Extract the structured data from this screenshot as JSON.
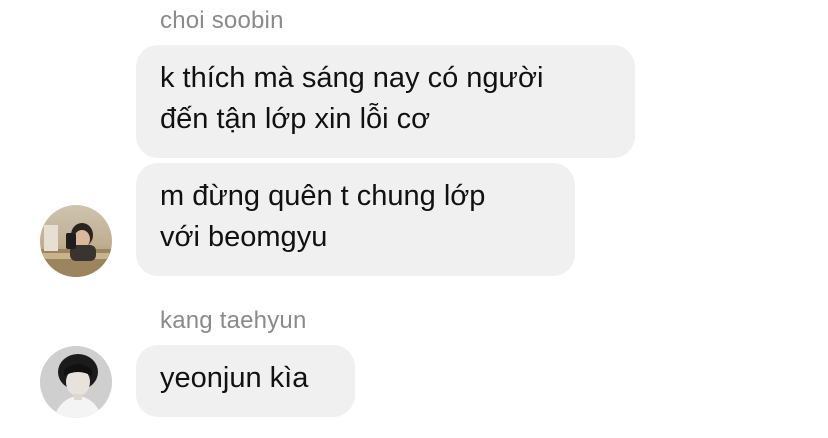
{
  "messages": {
    "group1": {
      "sender": "choi soobin",
      "bubble1": [
        "k thích mà sáng nay có người",
        "đến tận lớp xin lỗi cơ"
      ],
      "bubble2": [
        "m đừng quên t chung lớp",
        "với beomgyu"
      ],
      "avatar_icon": "user-avatar-icon"
    },
    "group2": {
      "sender": "kang taehyun",
      "bubble1": [
        "yeonjun kìa"
      ],
      "avatar_icon": "user-avatar-icon"
    }
  },
  "colors": {
    "bubble_bg": "#f0f0f0",
    "sender_text": "#8a8a8e",
    "message_text": "#111111"
  }
}
